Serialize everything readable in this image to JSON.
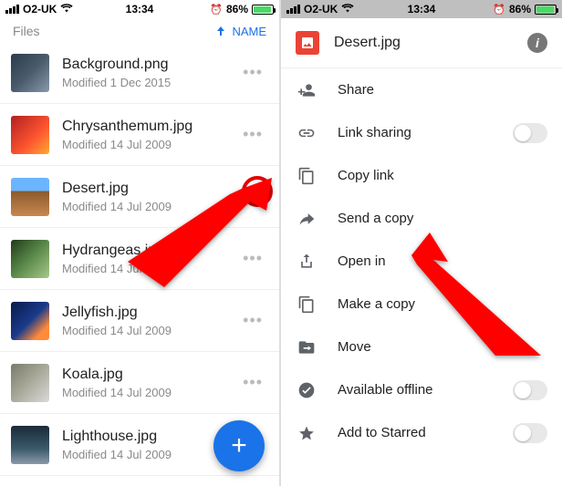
{
  "statusbar": {
    "carrier": "O2-UK",
    "wifi": true,
    "time": "13:34",
    "alarm": "⏰",
    "battery_pct": "86%"
  },
  "left": {
    "header_label": "Files",
    "sort_label": "NAME",
    "files": [
      {
        "name": "Background.png",
        "meta": "Modified 1 Dec 2015"
      },
      {
        "name": "Chrysanthemum.jpg",
        "meta": "Modified 14 Jul 2009"
      },
      {
        "name": "Desert.jpg",
        "meta": "Modified 14 Jul 2009"
      },
      {
        "name": "Hydrangeas.jpg",
        "meta": "Modified 14 Jul 2009"
      },
      {
        "name": "Jellyfish.jpg",
        "meta": "Modified 14 Jul 2009"
      },
      {
        "name": "Koala.jpg",
        "meta": "Modified 14 Jul 2009"
      },
      {
        "name": "Lighthouse.jpg",
        "meta": "Modified 14 Jul 2009"
      }
    ],
    "fab_label": "+"
  },
  "right": {
    "title": "Desert.jpg",
    "info_label": "i",
    "actions": [
      {
        "icon": "share-person",
        "label": "Share",
        "toggle": null
      },
      {
        "icon": "link",
        "label": "Link sharing",
        "toggle": false
      },
      {
        "icon": "copy",
        "label": "Copy link",
        "toggle": null
      },
      {
        "icon": "send",
        "label": "Send a copy",
        "toggle": null
      },
      {
        "icon": "open-in",
        "label": "Open in",
        "toggle": null
      },
      {
        "icon": "duplicate",
        "label": "Make a copy",
        "toggle": null
      },
      {
        "icon": "move",
        "label": "Move",
        "toggle": null
      },
      {
        "icon": "offline",
        "label": "Available offline",
        "toggle": false
      },
      {
        "icon": "star",
        "label": "Add to Starred",
        "toggle": false
      }
    ]
  },
  "highlight_colors": {
    "arrow": "#ff0000",
    "circle": "#e60000"
  }
}
